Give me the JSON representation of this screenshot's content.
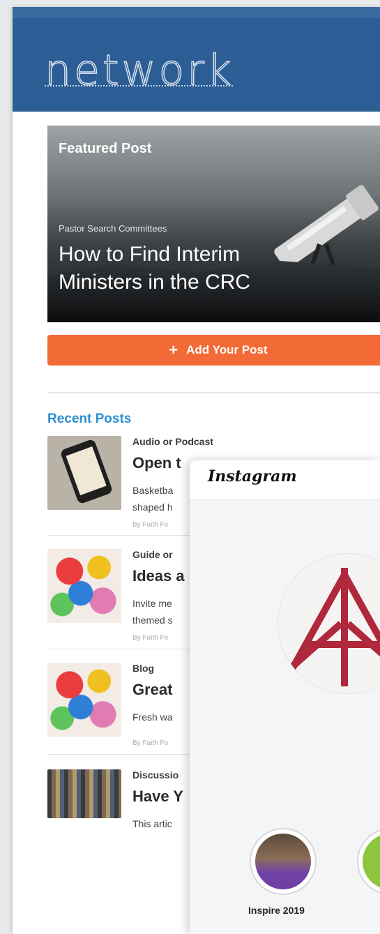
{
  "header": {
    "logo_text": "network"
  },
  "featured": {
    "label": "Featured Post",
    "category": "Pastor Search Committees",
    "title": "How to Find Interim Ministers in the CRC"
  },
  "actions": {
    "add_post_label": "Add Your Post"
  },
  "recent": {
    "heading": "Recent Posts",
    "posts": [
      {
        "category": "Audio or Podcast",
        "title": "Open t",
        "excerpt_1": "Basketba",
        "excerpt_2": "shaped h",
        "byline": "By Faith Fo"
      },
      {
        "category": "Guide or",
        "title": "Ideas a",
        "excerpt_1": "Invite me",
        "excerpt_2": "themed s",
        "byline": "By Faith Fo"
      },
      {
        "category": "Blog",
        "title": "Great",
        "excerpt_1": "Fresh wa",
        "excerpt_2": "",
        "byline": "By Faith Fo"
      },
      {
        "category": "Discussio",
        "title": "Have Y",
        "excerpt_1": "This artic",
        "excerpt_2": "",
        "byline": ""
      }
    ]
  },
  "instagram": {
    "brand": "Instagram",
    "highlight_label": "Inspire 2019"
  },
  "colors": {
    "header_blue": "#2c5d94",
    "accent_orange": "#f26a36",
    "link_blue": "#2a8dd1",
    "logo_red": "#b0283b"
  }
}
